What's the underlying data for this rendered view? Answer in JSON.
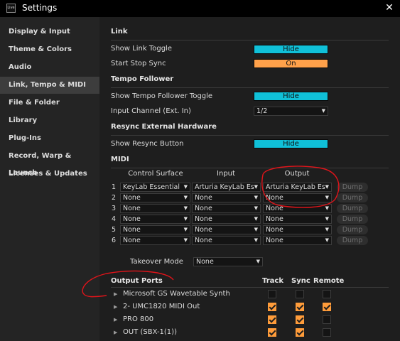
{
  "window": {
    "title": "Settings",
    "app_icon_label": "Live",
    "close_glyph": "✕"
  },
  "sidebar": {
    "items": [
      {
        "label": "Display & Input"
      },
      {
        "label": "Theme & Colors"
      },
      {
        "label": "Audio"
      },
      {
        "label": "Link, Tempo & MIDI",
        "active": true
      },
      {
        "label": "File & Folder"
      },
      {
        "label": "Library"
      },
      {
        "label": "Plug-Ins"
      },
      {
        "label": "Record, Warp & Launch"
      },
      {
        "label": "Licenses & Updates"
      }
    ]
  },
  "link": {
    "title": "Link",
    "show_link_toggle": {
      "label": "Show Link Toggle",
      "value": "Hide"
    },
    "start_stop_sync": {
      "label": "Start Stop Sync",
      "value": "On"
    }
  },
  "tempo_follower": {
    "title": "Tempo Follower",
    "show_toggle": {
      "label": "Show Tempo Follower Toggle",
      "value": "Hide"
    },
    "input_channel": {
      "label": "Input Channel (Ext. In)",
      "value": "1/2"
    }
  },
  "resync": {
    "title": "Resync External Hardware",
    "show_button": {
      "label": "Show Resync Button",
      "value": "Hide"
    }
  },
  "midi": {
    "title": "MIDI",
    "headers": {
      "control_surface": "Control Surface",
      "input": "Input",
      "output": "Output"
    },
    "dump_label": "Dump",
    "rows": [
      {
        "num": "1",
        "surface": "KeyLab Essential",
        "input": "Arturia KeyLab Es",
        "output": "Arturia KeyLab Es"
      },
      {
        "num": "2",
        "surface": "None",
        "input": "None",
        "output": "None"
      },
      {
        "num": "3",
        "surface": "None",
        "input": "None",
        "output": "None"
      },
      {
        "num": "4",
        "surface": "None",
        "input": "None",
        "output": "None"
      },
      {
        "num": "5",
        "surface": "None",
        "input": "None",
        "output": "None"
      },
      {
        "num": "6",
        "surface": "None",
        "input": "None",
        "output": "None"
      }
    ],
    "takeover": {
      "label": "Takeover Mode",
      "value": "None"
    }
  },
  "ports": {
    "title": "Output Ports",
    "headers": {
      "track": "Track",
      "sync": "Sync",
      "remote": "Remote"
    },
    "items": [
      {
        "name": "Microsoft GS Wavetable Synth",
        "track": false,
        "sync": false,
        "remote": false
      },
      {
        "name": "2- UMC1820 MIDI Out",
        "track": true,
        "sync": true,
        "remote": true
      },
      {
        "name": "PRO 800",
        "track": true,
        "sync": true,
        "remote": false
      },
      {
        "name": "OUT (SBX-1(1))",
        "track": true,
        "sync": true,
        "remote": false
      }
    ]
  },
  "colors": {
    "toggle_cyan": "#10c0d8",
    "toggle_orange": "#ffa14a",
    "annotation_red": "#e0141a"
  }
}
